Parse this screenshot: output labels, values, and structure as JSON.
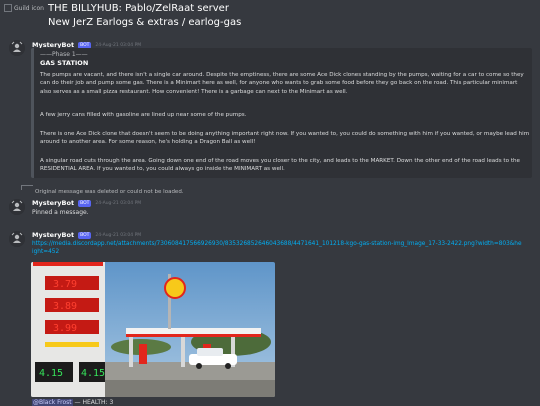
{
  "header": {
    "guild_icon_alt": "Guild icon",
    "title_line1": "THE BILLYHUB: Pablo/ZelRaat server",
    "title_line2": "New JerZ Earlogs & extras / earlog-gas"
  },
  "messages": [
    {
      "author": "MysteryBot",
      "bot_tag": "BOT",
      "timestamp": "24-Aug-21 03:04 PM",
      "embed": {
        "phase": "——Phase 1——",
        "title": "GAS STATION",
        "paragraphs": [
          "The pumps are vacant, and there isn't a single car around. Despite the emptiness, there are some Ace Dick clones standing by the pumps, waiting for a car to come so they can do their job and pump some gas. There is a Minimart here as well, for anyone who wants to grab some food before they go back on the road. This particular minimart also serves as a small pizza restaurant. How convenient! There is a garbage can next to the Minimart as well.",
          "A few jerry cans filled with gasoline are lined up near some of the pumps.",
          "There is one Ace Dick clone that doesn't seem to be doing anything important right now. If you wanted to, you could do something with him if you wanted, or maybe lead him around to another area. For some reason, he's holding a Dragon Ball as well!",
          "A singular road cuts through the area. Going down one end of the road moves you closer to the city, and leads to the MARKET. Down the other end of the road leads to the RESIDENTIAL AREA. If you wanted to, you could always go inside the MINIMART as well."
        ]
      }
    },
    {
      "system_note": "Original message was deleted or could not be loaded.",
      "author": "MysteryBot",
      "bot_tag": "BOT",
      "timestamp": "24-Aug-21 03:04 PM",
      "text": "Pinned a message."
    },
    {
      "author": "MysteryBot",
      "bot_tag": "BOT",
      "timestamp": "24-Aug-21 03:04 PM",
      "link": "https://media.discordapp.net/attachments/730608417566926930/835326852646043688/4471641_101218-kgo-gas-station-img_Image_17-33-2422.png?width=803&height=452",
      "image_name": "gas-station-photo",
      "prices": [
        "3.79",
        "3.89",
        "3.99",
        "4.15",
        "4.15"
      ]
    }
  ],
  "bottom": {
    "mention": "@Black Frost",
    "text": " — HEALTH: 3"
  }
}
